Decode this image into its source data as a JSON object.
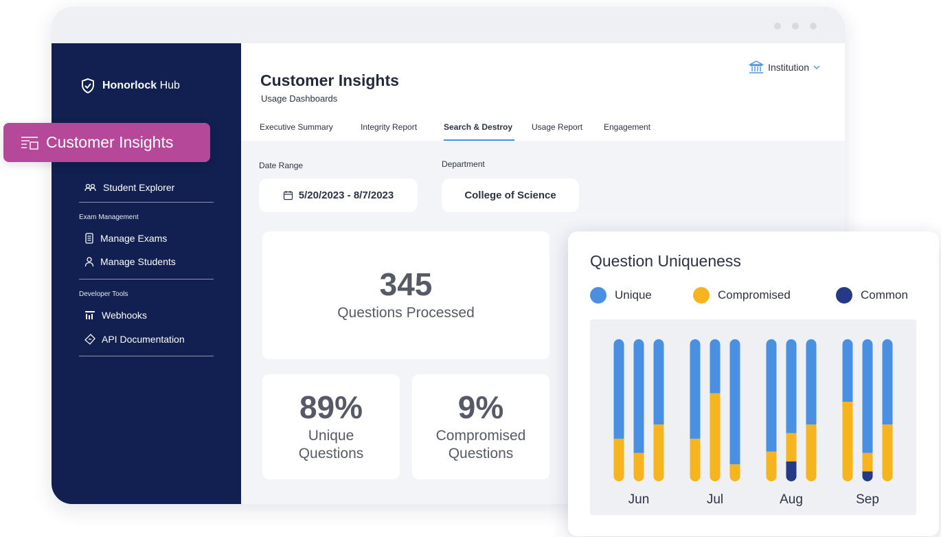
{
  "app": {
    "brand_bold": "Honorlock",
    "brand_light": "Hub"
  },
  "floating_label": "Customer Insights",
  "sidebar": {
    "items": [
      {
        "label": "Student Explorer",
        "icon": "users-icon"
      },
      {
        "label": "Manage Exams",
        "icon": "document-icon"
      },
      {
        "label": "Manage Students",
        "icon": "user-icon"
      },
      {
        "label": "Webhooks",
        "icon": "webhook-icon"
      },
      {
        "label": "API Documentation",
        "icon": "code-icon"
      }
    ],
    "sections": [
      "Exam Management",
      "Developer Tools"
    ]
  },
  "header": {
    "title": "Customer Insights",
    "subtitle": "Usage Dashboards",
    "scope_selector": "Institution",
    "tabs": [
      {
        "label": "Executive Summary",
        "active": false
      },
      {
        "label": "Integrity Report",
        "active": false
      },
      {
        "label": "Search & Destroy",
        "active": true
      },
      {
        "label": "Usage Report",
        "active": false
      },
      {
        "label": "Engagement",
        "active": false
      }
    ]
  },
  "filters": {
    "date_range_label": "Date Range",
    "date_range_value": "5/20/2023 - 8/7/2023",
    "department_label": "Department",
    "department_value": "College of Science"
  },
  "metrics": {
    "processed_value": "345",
    "processed_label": "Questions Processed",
    "unique_value": "89%",
    "unique_label": "Unique Questions",
    "compromised_value": "9%",
    "compromised_label": "Compromised Questions"
  },
  "colors": {
    "sidebar": "#112050",
    "accent_pink": "#b6489a",
    "unique": "#4a90e2",
    "compromised": "#f6b51e",
    "common": "#243a84",
    "tab_underline": "#4a90e2"
  },
  "chart_data": {
    "type": "bar",
    "stacked": true,
    "title": "Question Uniqueness",
    "legend_position": "top",
    "categories": [
      "Jun",
      "Jul",
      "Aug",
      "Sep"
    ],
    "bars_per_category": 3,
    "ylim": [
      0,
      100
    ],
    "series": [
      {
        "name": "Common",
        "color": "#243a84",
        "values": [
          0,
          0,
          0,
          0,
          0,
          0,
          0,
          14,
          0,
          0,
          7,
          0
        ]
      },
      {
        "name": "Compromised",
        "color": "#f6b51e",
        "values": [
          30,
          20,
          40,
          30,
          62,
          12,
          21,
          20,
          40,
          56,
          13,
          40
        ]
      },
      {
        "name": "Unique",
        "color": "#4a90e2",
        "values": [
          70,
          80,
          60,
          70,
          38,
          88,
          79,
          66,
          60,
          44,
          80,
          60
        ]
      }
    ]
  }
}
